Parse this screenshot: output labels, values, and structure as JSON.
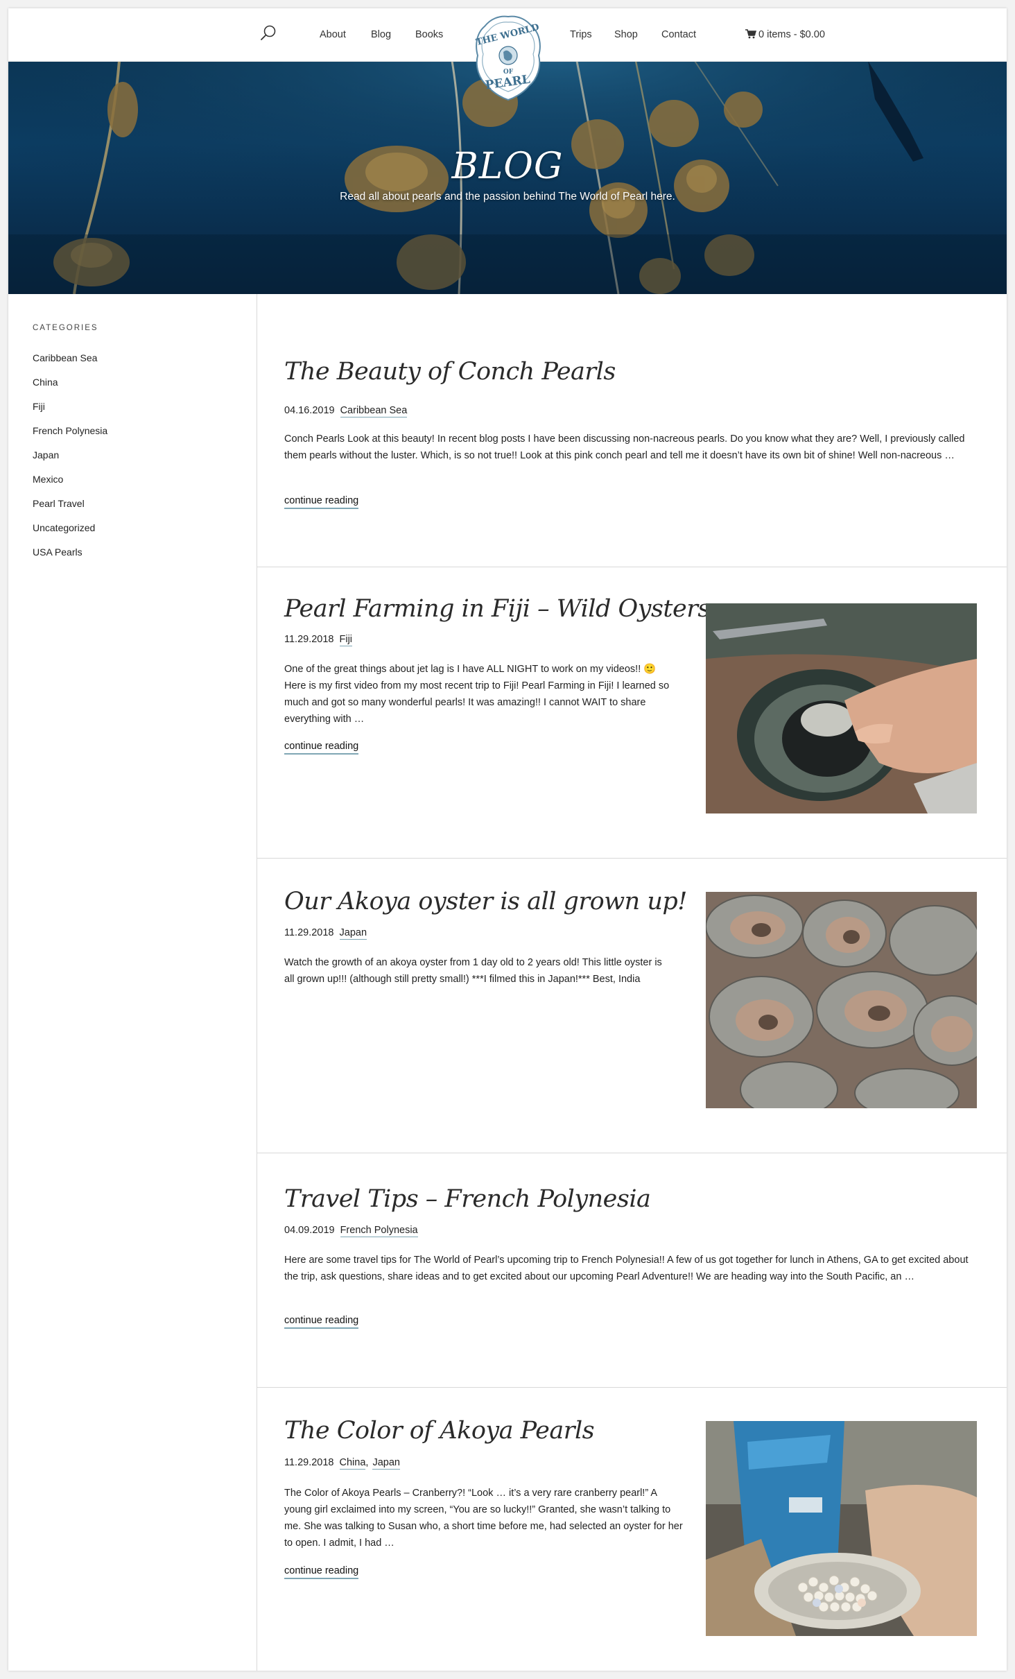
{
  "nav": {
    "links": [
      "About",
      "Blog",
      "Books",
      "Trips",
      "Shop",
      "Contact"
    ],
    "cart_label": "0 items - $0.00",
    "logo_text": "THE WORLD OF PEARL"
  },
  "hero": {
    "title": "BLOG",
    "subtitle": "Read all about pearls and the passion behind The World of Pearl here."
  },
  "sidebar": {
    "heading": "CATEGORIES",
    "items": [
      "Caribbean Sea",
      "China",
      "Fiji",
      "French Polynesia",
      "Japan",
      "Mexico",
      "Pearl Travel",
      "Uncategorized",
      "USA Pearls"
    ]
  },
  "posts": [
    {
      "title": "The Beauty of Conch Pearls",
      "date": "04.16.2019",
      "categories": [
        "Caribbean Sea"
      ],
      "excerpt": "Conch Pearls Look at this beauty! In recent blog posts I have been discussing non-nacreous pearls. Do you know what they are? Well, I previously called them pearls without the luster. Which, is so not true!! Look at this pink conch pearl and tell me it doesn’t have its own bit of shine! Well non-nacreous …",
      "more": "continue reading"
    },
    {
      "title": "Pearl Farming in Fiji – Wild Oysters",
      "date": "11.29.2018",
      "categories": [
        "Fiji"
      ],
      "excerpt": "One of the great things about jet lag is I have ALL NIGHT to work on my videos!! 🙂  Here is my first video from my most recent trip to Fiji! Pearl Farming in Fiji! I learned so much and got so many wonderful pearls! It was amazing!! I cannot WAIT to share everything with …",
      "more": "continue reading"
    },
    {
      "title": "Our Akoya oyster is all grown up!",
      "date": "11.29.2018",
      "categories": [
        "Japan"
      ],
      "excerpt": "Watch the growth of an akoya oyster from 1 day old to 2 years old! This little oyster is all grown up!!! (although still pretty small!) ***I filmed this in Japan!*** Best, India"
    },
    {
      "title": "Travel Tips – French Polynesia",
      "date": "04.09.2019",
      "categories": [
        "French Polynesia"
      ],
      "excerpt": "Here are some travel tips for The World of Pearl’s upcoming trip to French Polynesia!! A few of us got together for lunch in Athens, GA to get excited about the trip, ask questions, share ideas and to get excited about our upcoming Pearl Adventure!!   We are heading way into the South Pacific, an …",
      "more": "continue reading"
    },
    {
      "title": "The Color of Akoya Pearls",
      "date": "11.29.2018",
      "categories": [
        "China",
        "Japan"
      ],
      "excerpt": "The Color of Akoya Pearls – Cranberry?! “Look … it’s a very rare cranberry pearl!” A young girl exclaimed into my screen, “You are so lucky!!” Granted, she wasn’t talking to me. She was talking to Susan who, a short time before me, had selected an oyster for her to open. I admit, I had …",
      "more": "continue reading"
    }
  ]
}
